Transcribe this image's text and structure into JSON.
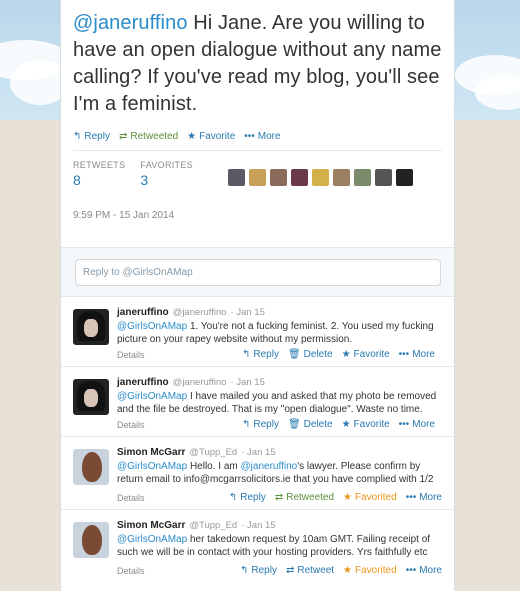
{
  "main_tweet": {
    "mention": "@janeruffino",
    "text": " Hi Jane. Are you willing to have an open dialogue without any name calling? If you've read my blog, you'll see I'm a feminist.",
    "actions": {
      "reply": "Reply",
      "retweeted": "Retweeted",
      "favorite": "Favorite",
      "more": "More"
    },
    "stats": {
      "retweets_label": "RETWEETS",
      "retweets_value": "8",
      "favorites_label": "FAVORITES",
      "favorites_value": "3"
    },
    "timestamp": "9:59 PM - 15 Jan 2014"
  },
  "reply_box": {
    "placeholder": "Reply to @GirlsOnAMap"
  },
  "replies": [
    {
      "name": "janeruffino",
      "handle": "@janeruffino",
      "date": "Jan 15",
      "mention": "@GirlsOnAMap",
      "text": " 1. You're not a fucking feminist. 2. You used my fucking picture on your rapey website without my permission.",
      "details": "Details",
      "actions": [
        "Reply",
        "Delete",
        "Favorite",
        "More"
      ]
    },
    {
      "name": "janeruffino",
      "handle": "@janeruffino",
      "date": "Jan 15",
      "mention": "@GirlsOnAMap",
      "text": " I have mailed you and asked that my photo be removed and the file be destroyed. That is my \"open dialogue\". Waste no time.",
      "details": "Details",
      "actions": [
        "Reply",
        "Delete",
        "Favorite",
        "More"
      ]
    },
    {
      "name": "Simon McGarr",
      "handle": "@Tupp_Ed",
      "date": "Jan 15",
      "mention": "@GirlsOnAMap",
      "text_a": " Hello. I am ",
      "mention2": "@janeruffino",
      "text_b": "'s lawyer. Please confirm by return email to info@mcgarrsolicitors.ie that you have complied with 1/2",
      "details": "Details",
      "actions": [
        "Reply",
        "Retweeted",
        "Favorited",
        "More"
      ]
    },
    {
      "name": "Simon McGarr",
      "handle": "@Tupp_Ed",
      "date": "Jan 15",
      "mention": "@GirlsOnAMap",
      "text": " her takedown request by 10am GMT. Failing receipt of such we will be in contact with your hosting providers. Yrs faithfully etc",
      "details": "Details",
      "actions": [
        "Reply",
        "Retweet",
        "Favorited",
        "More"
      ]
    }
  ],
  "icons": {
    "reply": "reply-arrow-icon",
    "retweet": "retweet-icon",
    "favorite": "star-icon",
    "more": "ellipsis-icon",
    "delete": "trash-icon"
  },
  "colors": {
    "link": "#2a8cc8",
    "retweeted": "#5c913b",
    "favorited": "#e8961c"
  }
}
